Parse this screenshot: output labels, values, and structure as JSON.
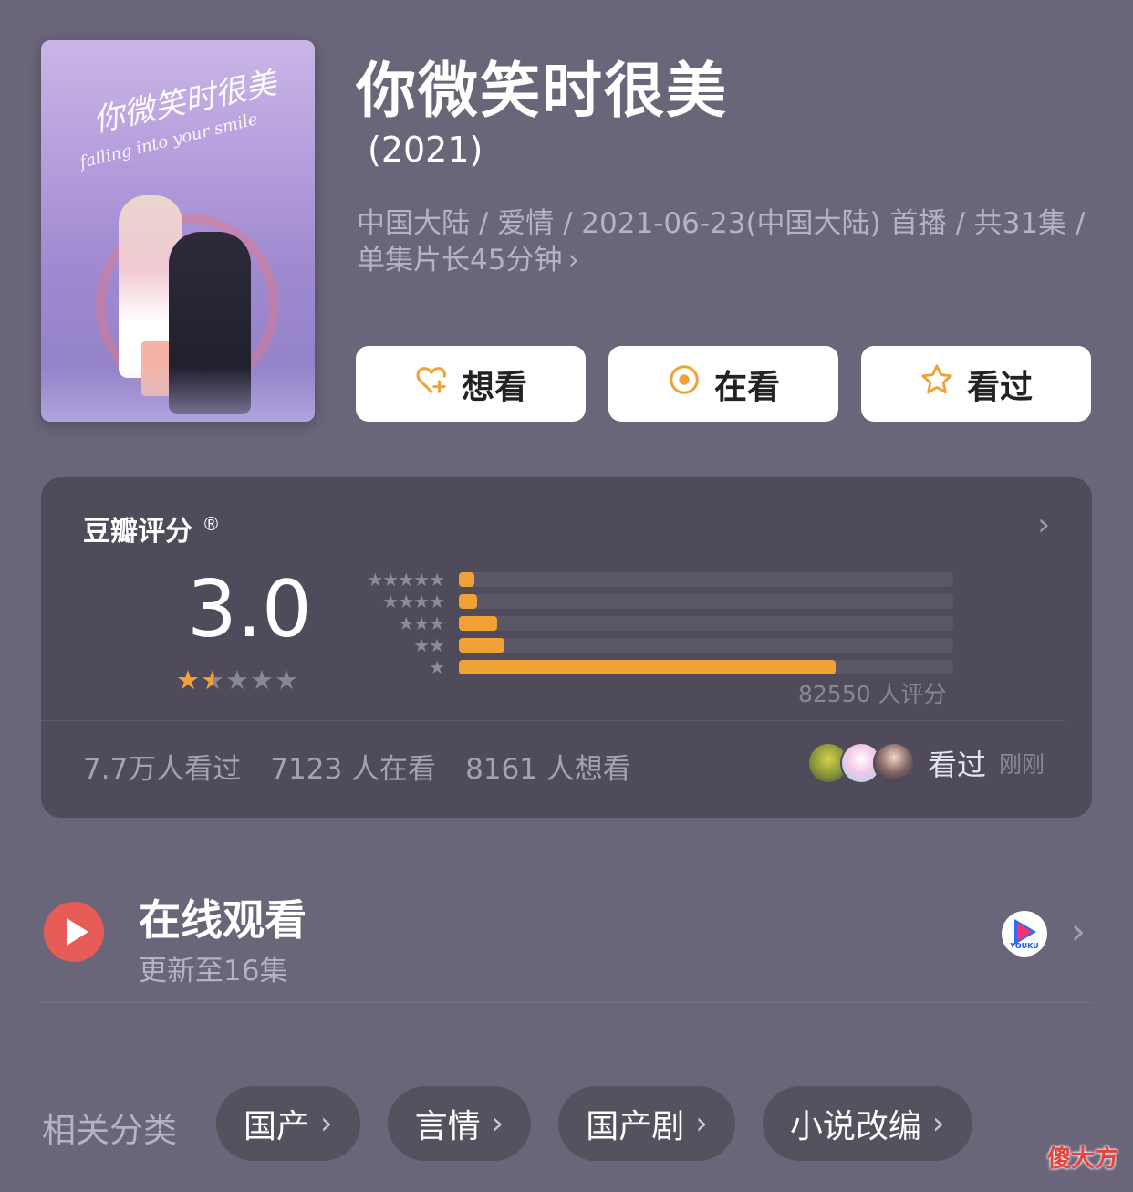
{
  "movie": {
    "title": "你微笑时很美",
    "year": "(2021)",
    "meta": "中国大陆 / 爱情 / 2021-06-23(中国大陆) 首播 / 共31集 / 单集片长45分钟",
    "meta_chevron": "›",
    "poster": {
      "title_cn": "你微笑时很美",
      "title_en": "falling into your smile"
    }
  },
  "actions": [
    {
      "label": "想看",
      "icon": "heart-plus-icon"
    },
    {
      "label": "在看",
      "icon": "target-circle-icon"
    },
    {
      "label": "看过",
      "icon": "star-outline-icon"
    }
  ],
  "accent_color": "#f2a235",
  "rating": {
    "label": "豆瓣评分",
    "registered": "®",
    "chevron": "›",
    "score": "3.0",
    "stars_value": 1.5,
    "stars": [
      "★",
      "★",
      "★",
      "★",
      "★"
    ],
    "distribution": [
      {
        "stars": "★★★★★",
        "percent": 3.2
      },
      {
        "stars": "★★★★",
        "percent": 3.6
      },
      {
        "stars": "★★★",
        "percent": 7.8
      },
      {
        "stars": "★★",
        "percent": 9.2
      },
      {
        "stars": "★",
        "percent": 76.2
      }
    ],
    "count": "82550 人评分",
    "stats": [
      "7.7万人看过",
      "7123 人在看",
      "8161 人想看"
    ],
    "friend_action": "看过",
    "friend_time": "刚刚"
  },
  "watch": {
    "title": "在线观看",
    "subtitle": "更新至16集",
    "platform": "YOUKU",
    "chevron": "›"
  },
  "categories": {
    "label": "相关分类",
    "items": [
      "国产",
      "言情",
      "国产剧",
      "小说改编"
    ],
    "chevron": "›"
  },
  "watermark": "傻大方"
}
